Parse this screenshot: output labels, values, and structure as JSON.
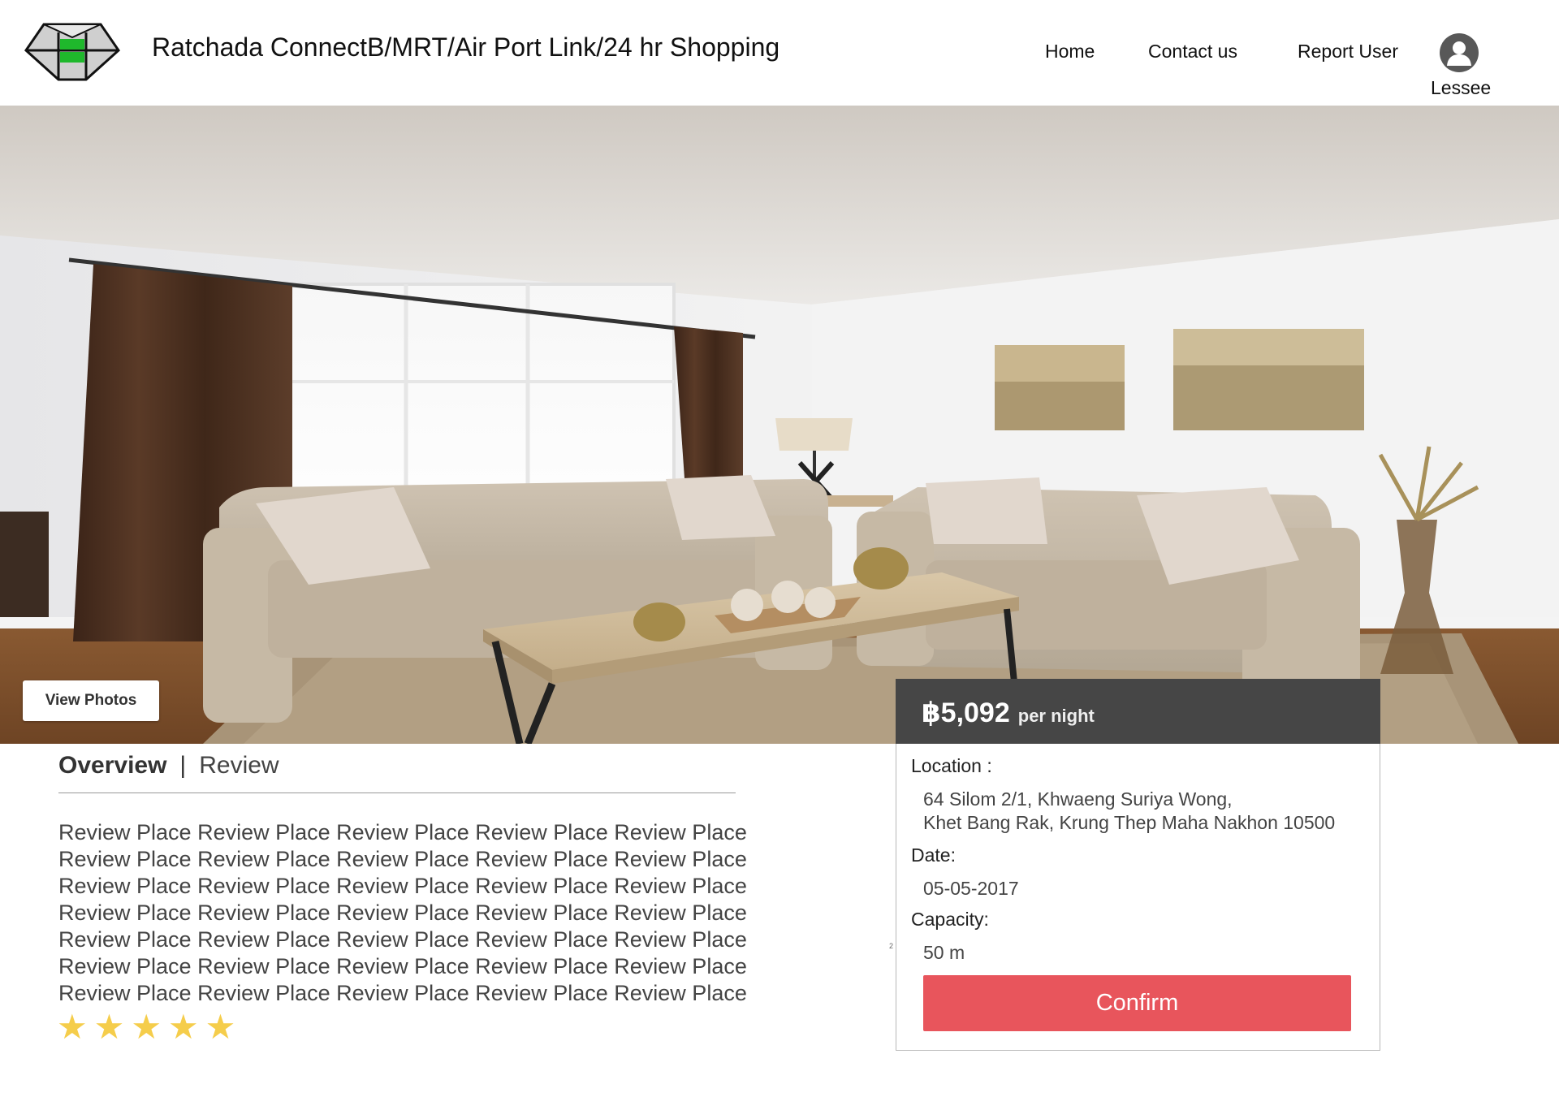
{
  "header": {
    "title": "Ratchada ConnectB/MRT/Air Port Link/24 hr Shopping",
    "nav": [
      "Home",
      "Contact us",
      "Report User"
    ],
    "user_label": "Lessee"
  },
  "hero": {
    "view_photos_label": "View Photos"
  },
  "booking": {
    "price": "฿5,092",
    "price_unit": "per night",
    "location_label": "Location :",
    "location_line1": "64 Silom 2/1, Khwaeng Suriya Wong,",
    "location_line2": "Khet Bang Rak, Krung Thep Maha Nakhon 10500",
    "date_label": "Date:",
    "date_value": "05-05-2017",
    "capacity_label": "Capacity:",
    "capacity_value": "50 m",
    "capacity_mark": "2",
    "confirm_label": "Confirm"
  },
  "overview": {
    "tabs": [
      "Overview",
      "Review"
    ],
    "separator": "|",
    "review_lines": [
      "Review Place Review Place Review Place Review Place Review Place",
      "Review Place Review Place Review Place Review Place Review Place",
      "Review Place Review Place Review Place Review Place Review Place",
      "Review Place Review Place Review Place Review Place Review Place",
      "Review Place Review Place Review Place Review Place Review Place",
      "Review Place Review Place Review Place Review Place Review Place",
      "Review Place Review Place Review Place Review Place Review Place"
    ],
    "rating": 5,
    "rating_max": 5
  },
  "colors": {
    "accent_confirm": "#e8555c",
    "price_bar": "#464646",
    "star": "#f5cd4b",
    "logo_green": "#1fb82c"
  },
  "icons": [
    "logo-icon",
    "user-avatar-icon",
    "star-icon"
  ]
}
